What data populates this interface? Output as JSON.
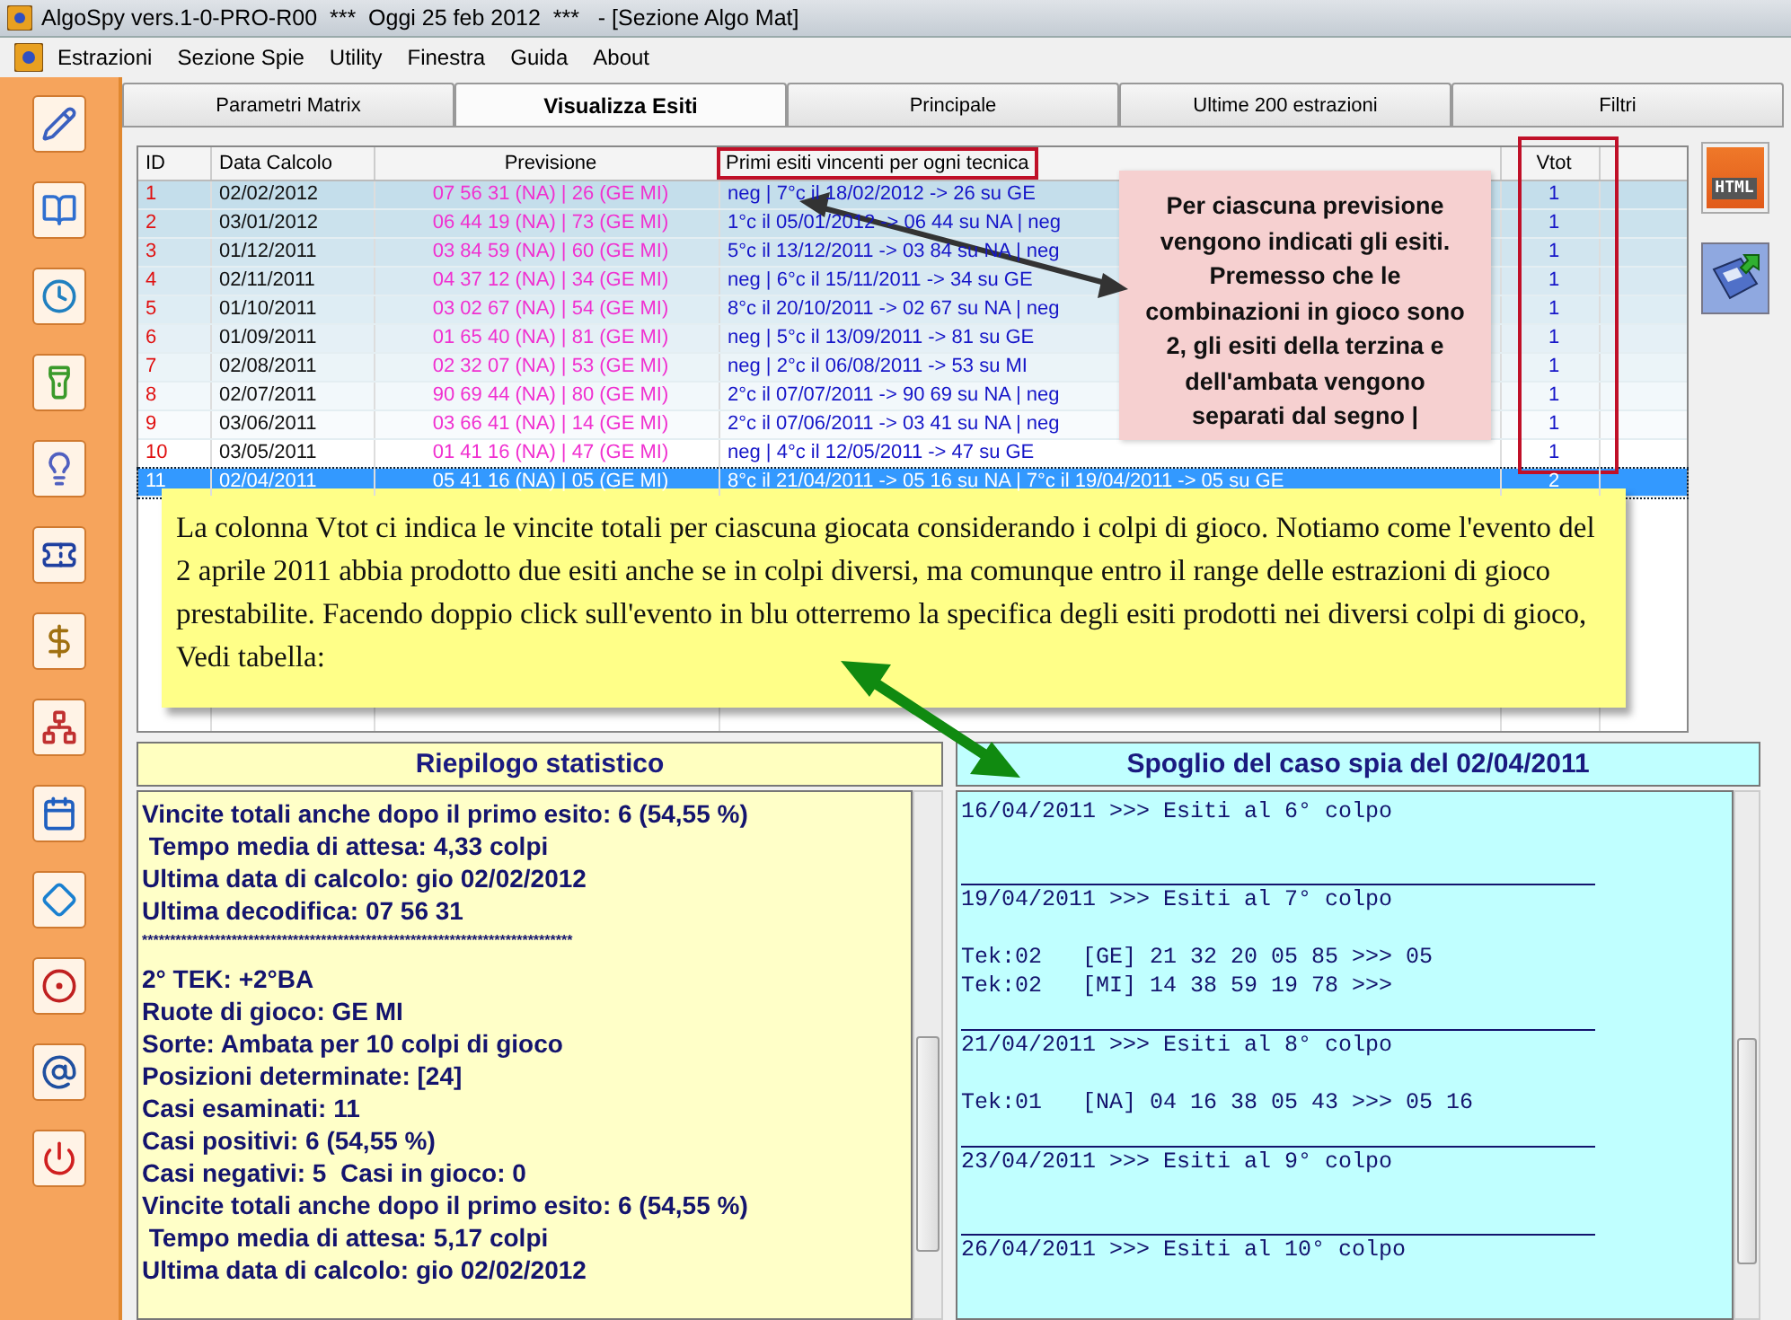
{
  "window": {
    "title": "AlgoSpy vers.1-0-PRO-R00  ***  Oggi 25 feb 2012  ***   - [Sezione Algo Mat]"
  },
  "menu": [
    "Estrazioni",
    "Sezione Spie",
    "Utility",
    "Finestra",
    "Guida",
    "About"
  ],
  "tabs": [
    {
      "label": "Parametri Matrix",
      "selected": false
    },
    {
      "label": "Visualizza Esiti",
      "selected": true
    },
    {
      "label": "Principale",
      "selected": false
    },
    {
      "label": "Ultime 200 estrazioni",
      "selected": false
    },
    {
      "label": "Filtri",
      "selected": false
    }
  ],
  "table": {
    "columns": [
      "ID",
      "Data Calcolo",
      "Previsione",
      "Primi esiti vincenti per ogni tecnica",
      "Vtot"
    ],
    "rows": [
      {
        "id": "1",
        "date": "02/02/2012",
        "forecast": "07 56 31 (NA) | 26 (GE MI)",
        "outcome": "neg | 7°c il 18/02/2012 -> 26 su GE",
        "vtot": "1",
        "selected": false
      },
      {
        "id": "2",
        "date": "03/01/2012",
        "forecast": "06 44 19 (NA) | 73 (GE MI)",
        "outcome": "1°c il 05/01/2012 -> 06 44 su NA | neg",
        "vtot": "1",
        "selected": false
      },
      {
        "id": "3",
        "date": "01/12/2011",
        "forecast": "03 84 59 (NA) | 60 (GE MI)",
        "outcome": "5°c il 13/12/2011 -> 03 84 su NA | neg",
        "vtot": "1",
        "selected": false
      },
      {
        "id": "4",
        "date": "02/11/2011",
        "forecast": "04 37 12 (NA) | 34 (GE MI)",
        "outcome": "neg | 6°c il 15/11/2011 -> 34 su GE",
        "vtot": "1",
        "selected": false
      },
      {
        "id": "5",
        "date": "01/10/2011",
        "forecast": "03 02 67 (NA) | 54 (GE MI)",
        "outcome": "8°c il 20/10/2011 -> 02 67 su NA | neg",
        "vtot": "1",
        "selected": false
      },
      {
        "id": "6",
        "date": "01/09/2011",
        "forecast": "01 65 40 (NA) | 81 (GE MI)",
        "outcome": "neg | 5°c il 13/09/2011 -> 81 su GE",
        "vtot": "1",
        "selected": false
      },
      {
        "id": "7",
        "date": "02/08/2011",
        "forecast": "02 32 07 (NA) | 53 (GE MI)",
        "outcome": "neg | 2°c il 06/08/2011 -> 53 su MI",
        "vtot": "1",
        "selected": false
      },
      {
        "id": "8",
        "date": "02/07/2011",
        "forecast": "90 69 44 (NA) | 80 (GE MI)",
        "outcome": "2°c il 07/07/2011 -> 90 69 su NA | neg",
        "vtot": "1",
        "selected": false
      },
      {
        "id": "9",
        "date": "03/06/2011",
        "forecast": "03 66 41 (NA) | 14 (GE MI)",
        "outcome": "2°c il 07/06/2011 -> 03 41 su NA | neg",
        "vtot": "1",
        "selected": false
      },
      {
        "id": "10",
        "date": "03/05/2011",
        "forecast": "01 41 16 (NA) | 47 (GE MI)",
        "outcome": "neg | 4°c il 12/05/2011 -> 47 su GE",
        "vtot": "1",
        "selected": false
      },
      {
        "id": "11",
        "date": "02/04/2011",
        "forecast": "05 41 16 (NA) | 05 (GE MI)",
        "outcome": "8°c il 21/04/2011 -> 05 16 su NA | 7°c il 19/04/2011 -> 05 su GE",
        "vtot": "2",
        "selected": true
      }
    ]
  },
  "callout_note": {
    "text": "Per ciascuna previsione vengono indicati gli esiti. Premesso che le combinazioni in gioco sono 2, gli esiti della terzina e dell'ambata vengono separati dal segno |"
  },
  "comment_note": {
    "text": "La colonna Vtot ci indica le vincite totali per ciascuna giocata considerando i colpi di gioco. Notiamo come l'evento del 2 aprile 2011 abbia prodotto due esiti anche se in colpi diversi, ma comunque entro il range delle estrazioni di gioco prestabilite. Facendo doppio click sull'evento in blu otterremo la specifica degli esiti prodotti nei diversi colpi di gioco, Vedi tabella:"
  },
  "right_toolbar": {
    "html_label": "HTML"
  },
  "summary": {
    "title": "Riepilogo statistico",
    "lines": [
      "Vincite totali anche dopo il primo esito: 6 (54,55 %)",
      " Tempo media di attesa: 4,33 colpi",
      "Ultima data di calcolo: gio 02/02/2012",
      "Ultima decodifica: 07 56 31",
      "*****************************************************************************",
      "2° TEK: +2°BA",
      "Ruote di gioco: GE MI",
      "Sorte: Ambata per 10 colpi di gioco",
      "Posizioni determinate: [24]",
      "Casi esaminati: 11",
      "Casi positivi: 6 (54,55 %)",
      "Casi negativi: 5  Casi in gioco: 0",
      "Vincite totali anche dopo il primo esito: 6 (54,55 %)",
      " Tempo media di attesa: 5,17 colpi",
      "Ultima data di calcolo: gio 02/02/2012"
    ]
  },
  "detail": {
    "title": "Spoglio del caso spia del 02/04/2011",
    "entries": [
      {
        "heading": "16/04/2011 >>> Esiti al 6° colpo"
      },
      {
        "heading": "19/04/2011 >>> Esiti al 7° colpo",
        "lines": [
          "Tek:02   [GE] 21 32 20 05 85 >>> 05",
          "Tek:02   [MI] 14 38 59 19 78 >>>"
        ]
      },
      {
        "heading": "21/04/2011 >>> Esiti al 8° colpo",
        "lines": [
          "Tek:01   [NA] 04 16 38 05 43 >>> 05 16"
        ]
      },
      {
        "heading": "23/04/2011 >>> Esiti al 9° colpo"
      },
      {
        "heading": "26/04/2011 >>> Esiti al 10° colpo"
      }
    ]
  }
}
